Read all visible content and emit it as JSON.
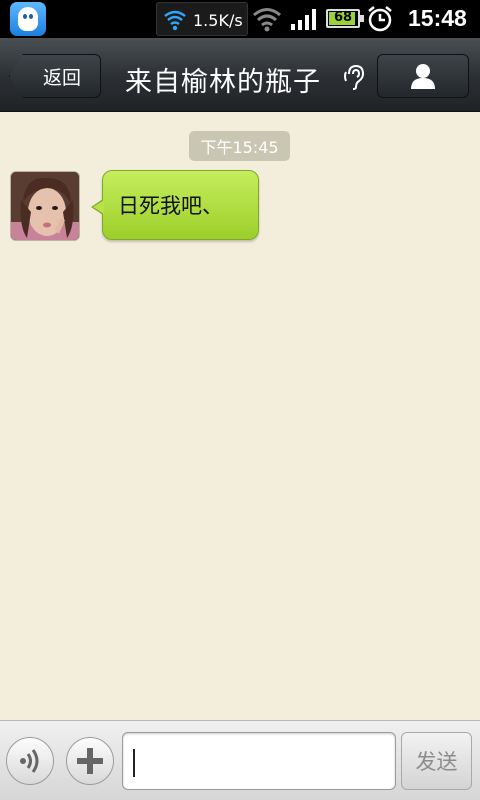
{
  "status_bar": {
    "net_speed": "1.5K/s",
    "battery_level": "68",
    "time": "15:48",
    "icons": [
      "qq-app-icon",
      "wifi-icon",
      "wifi-signal-icon",
      "cell-signal-icon",
      "battery-icon",
      "alarm-icon"
    ]
  },
  "header": {
    "back_label": "返回",
    "title": "来自榆林的瓶子",
    "icons": [
      "ear-icon",
      "profile-icon"
    ]
  },
  "chat": {
    "timestamp": "下午15:45",
    "messages": [
      {
        "sender": "other",
        "text": "日死我吧、"
      }
    ]
  },
  "input_bar": {
    "text_value": "",
    "send_label": "发送",
    "icons": [
      "voice-icon",
      "plus-icon"
    ]
  },
  "colors": {
    "background": "#f2eedb",
    "bubble_green": "#b8e24b",
    "titlebar": "#2b2f33"
  }
}
